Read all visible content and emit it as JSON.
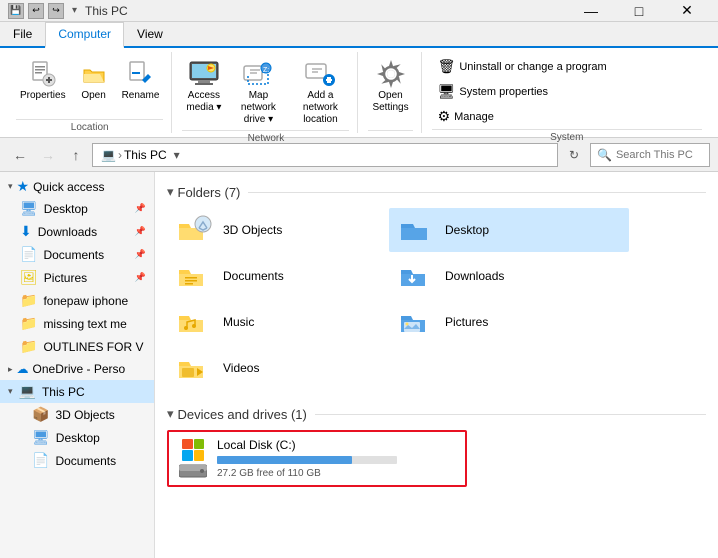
{
  "titleBar": {
    "title": "This PC",
    "quickAccessIcons": [
      "save",
      "undo",
      "redo"
    ],
    "controls": [
      "—",
      "□",
      "✕"
    ]
  },
  "ribbonTabs": [
    {
      "id": "file",
      "label": "File"
    },
    {
      "id": "computer",
      "label": "Computer",
      "active": true
    },
    {
      "id": "view",
      "label": "View"
    }
  ],
  "ribbonGroups": [
    {
      "id": "location",
      "label": "Location",
      "buttons": [
        {
          "id": "properties",
          "icon": "⊞",
          "label": "Properties"
        },
        {
          "id": "open",
          "icon": "📂",
          "label": "Open"
        },
        {
          "id": "rename",
          "icon": "✏️",
          "label": "Rename"
        }
      ]
    },
    {
      "id": "network",
      "label": "Network",
      "buttons": [
        {
          "id": "access-media",
          "icon": "🖥",
          "label": "Access\nmedia"
        },
        {
          "id": "map-network",
          "icon": "🗺",
          "label": "Map network\ndrive"
        },
        {
          "id": "add-network",
          "icon": "➕",
          "label": "Add a network\nlocation"
        }
      ]
    },
    {
      "id": "settings-group",
      "label": "",
      "buttons": [
        {
          "id": "open-settings",
          "icon": "⚙",
          "label": "Open\nSettings"
        }
      ]
    },
    {
      "id": "system",
      "label": "System",
      "rightButtons": [
        {
          "id": "uninstall",
          "label": "Uninstall or change a program"
        },
        {
          "id": "system-props",
          "label": "System properties"
        },
        {
          "id": "manage",
          "label": "Manage"
        }
      ]
    }
  ],
  "addressBar": {
    "backDisabled": false,
    "forwardDisabled": true,
    "upDisabled": false,
    "path": [
      "This PC"
    ],
    "searchPlaceholder": "Search This PC"
  },
  "sidebar": {
    "sections": [
      {
        "id": "quick-access",
        "label": "Quick access",
        "expanded": true,
        "items": [
          {
            "id": "desktop",
            "label": "Desktop",
            "pinned": true,
            "icon": "🖥"
          },
          {
            "id": "downloads",
            "label": "Downloads",
            "pinned": true,
            "icon": "⬇"
          },
          {
            "id": "documents",
            "label": "Documents",
            "pinned": true,
            "icon": "📄"
          },
          {
            "id": "pictures",
            "label": "Pictures",
            "pinned": true,
            "icon": "🖼"
          },
          {
            "id": "fonepaw",
            "label": "fonepaw iphone",
            "icon": "📁"
          },
          {
            "id": "missing",
            "label": "missing text me",
            "icon": "📁"
          },
          {
            "id": "outlines",
            "label": "OUTLINES FOR V",
            "icon": "📁"
          }
        ]
      },
      {
        "id": "onedrive",
        "label": "OneDrive - Perso",
        "expanded": false,
        "icon": "☁"
      },
      {
        "id": "this-pc",
        "label": "This PC",
        "expanded": true,
        "selected": true,
        "icon": "💻",
        "items": [
          {
            "id": "3d-objects",
            "label": "3D Objects",
            "icon": "📦"
          },
          {
            "id": "desktop-sub",
            "label": "Desktop",
            "icon": "🖥"
          },
          {
            "id": "documents-sub",
            "label": "Documents",
            "icon": "📄"
          }
        ]
      }
    ]
  },
  "content": {
    "foldersSection": {
      "label": "Folders (7)",
      "folders": [
        {
          "id": "3d-objects",
          "name": "3D Objects",
          "type": "3d"
        },
        {
          "id": "desktop",
          "name": "Desktop",
          "selected": true
        },
        {
          "id": "documents",
          "name": "Documents"
        },
        {
          "id": "downloads",
          "name": "Downloads"
        },
        {
          "id": "music",
          "name": "Music"
        },
        {
          "id": "pictures",
          "name": "Pictures"
        },
        {
          "id": "videos",
          "name": "Videos"
        }
      ]
    },
    "devicesSection": {
      "label": "Devices and drives (1)",
      "drives": [
        {
          "id": "local-disk",
          "name": "Local Disk (C:)",
          "freeGB": 27.2,
          "totalGB": 110,
          "usedPercent": 75,
          "freeLabel": "27.2 GB free of 110 GB"
        }
      ]
    }
  }
}
